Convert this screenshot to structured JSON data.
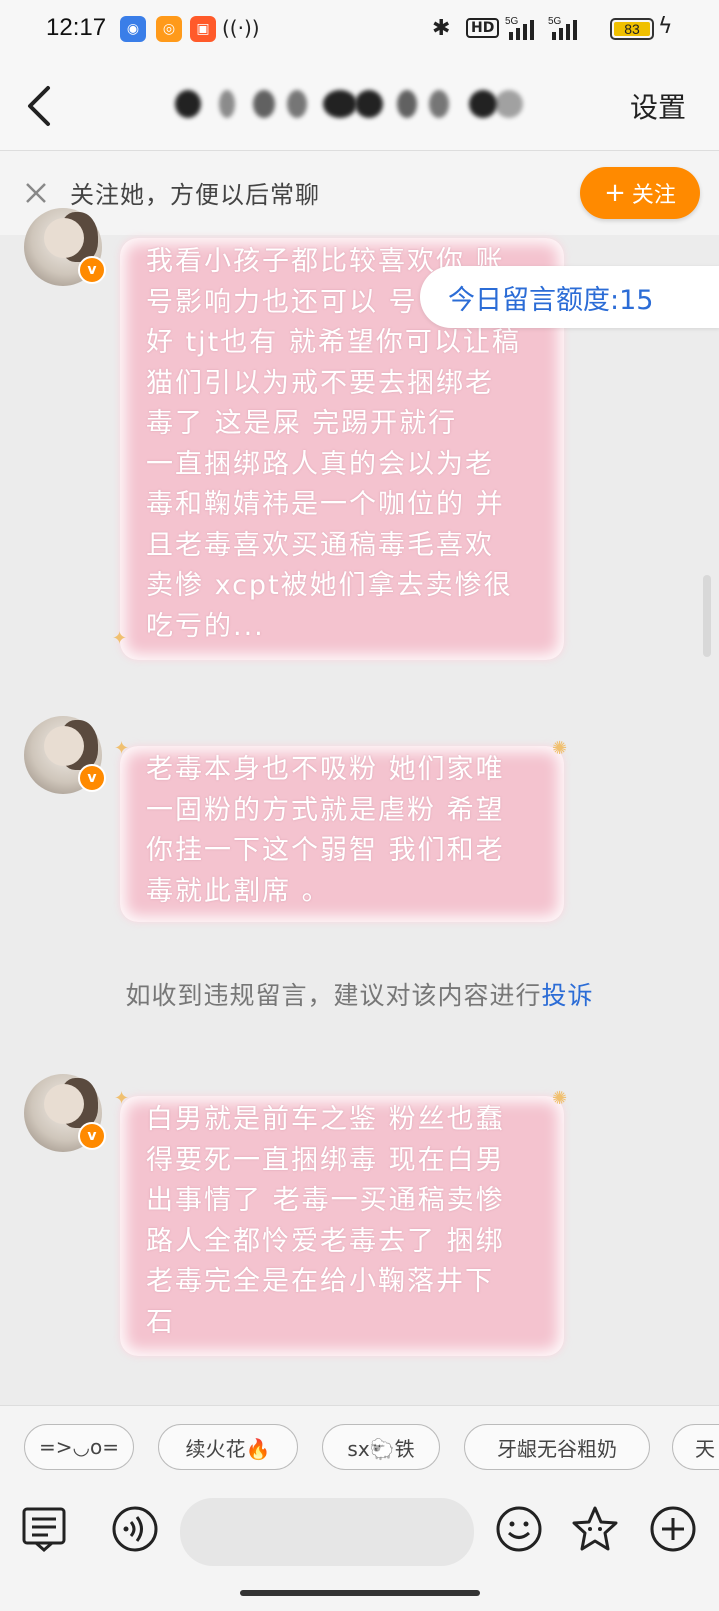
{
  "status_bar": {
    "time": "12:17",
    "battery": "83",
    "network": "HD 5G 5G",
    "app_icons": [
      "baidu-icon",
      "weibo-icon",
      "app-icon"
    ]
  },
  "header": {
    "settings_label": "设置"
  },
  "follow_bar": {
    "text": "关注她，方便以后常聊",
    "button_label": "关注",
    "button_plus": "+"
  },
  "quota": {
    "text": "今日留言额度:15"
  },
  "messages": [
    {
      "lines": [
        "我看小孩子都比较喜欢你 账",
        "号影响力也还可以 号",
        "好 tjt也有 就希望你可以让稿",
        "猫们引以为戒不要去捆绑老",
        "毒了 这是屎 完踢开就行",
        "一直捆绑路人真的会以为老",
        "毒和鞠婧祎是一个咖位的 并",
        "且老毒喜欢买通稿毒毛喜欢",
        "卖惨 xcpt被她们拿去卖惨很",
        "吃亏的..."
      ]
    },
    {
      "lines": [
        "老毒本身也不吸粉 她们家唯",
        "一固粉的方式就是虐粉 希望",
        "你挂一下这个弱智 我们和老",
        "毒就此割席 。"
      ]
    },
    {
      "lines": [
        "白男就是前车之鉴 粉丝也蠢",
        "得要死一直捆绑毒 现在白男",
        "出事情了 老毒一买通稿卖惨",
        "路人全都怜爱老毒去了 捆绑",
        "老毒完全是在给小鞠落井下",
        "石"
      ]
    }
  ],
  "notice": {
    "text": "如收到违规留言，建议对该内容进行",
    "link": "投诉"
  },
  "chips": [
    "=>◡o=",
    "续火花🔥",
    "sx🐑铁",
    "牙龈无谷粗奶",
    "天"
  ],
  "colors": {
    "accent_orange": "#ff8a00",
    "link_blue": "#2b6cd6",
    "bubble_pink": "#f4c3cf"
  }
}
